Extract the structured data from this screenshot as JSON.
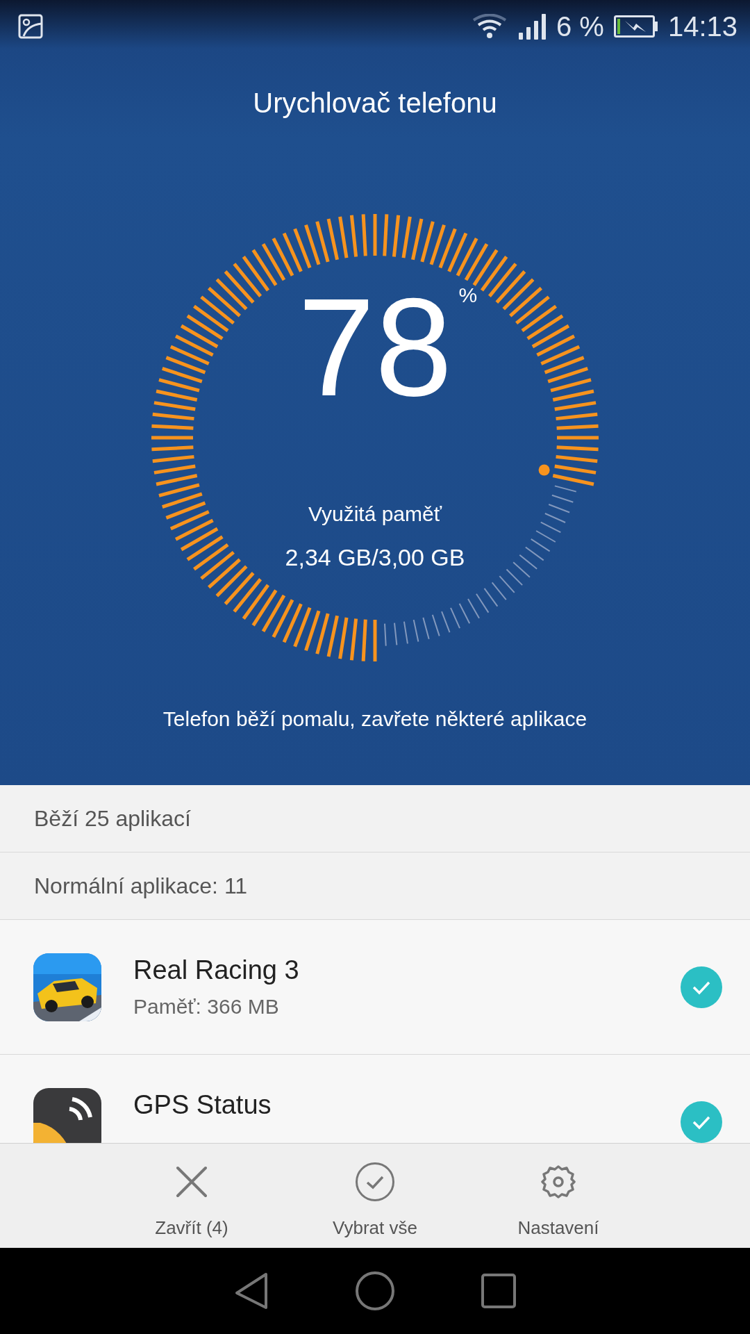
{
  "status_bar": {
    "battery_text": "6 %",
    "time": "14:13"
  },
  "title": "Urychlovač telefonu",
  "memory_gauge": {
    "value": "78",
    "unit": "%",
    "label": "Využitá paměť",
    "reading": "2,34 GB/3,00 GB"
  },
  "message": "Telefon běží pomalu, zavřete některé aplikace",
  "summary": "Běží 25 aplikací",
  "section_header": "Normální aplikace: 11",
  "apps": [
    {
      "kind": "racing",
      "name": "Real Racing 3",
      "memory": "Paměť: 366 MB",
      "checked": true
    },
    {
      "kind": "gps",
      "name": "GPS Status",
      "checked": true
    }
  ],
  "actions": [
    {
      "kind": "close",
      "label": "Zavřít (4)"
    },
    {
      "kind": "select-all",
      "label": "Vybrat vše"
    },
    {
      "kind": "settings",
      "label": "Nastavení"
    }
  ]
}
